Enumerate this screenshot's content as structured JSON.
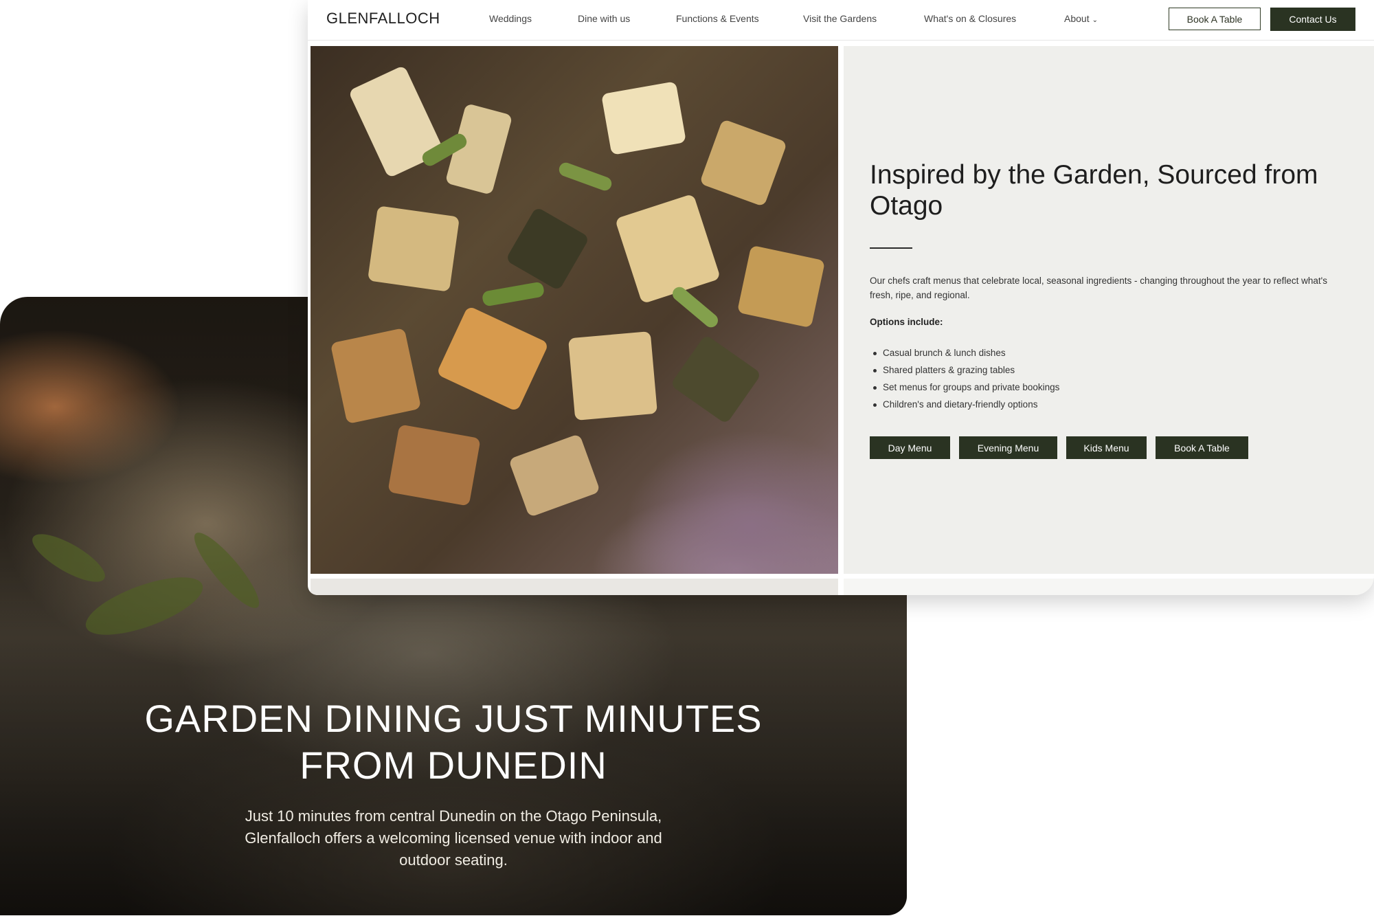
{
  "hero": {
    "title_line1": "GARDEN DINING JUST MINUTES",
    "title_line2": "FROM DUNEDIN",
    "text": "Just 10 minutes from central Dunedin on the Otago Peninsula, Glenfalloch offers a welcoming licensed venue with indoor and outdoor seating."
  },
  "nav": {
    "logo": "GLENFALLOCH",
    "links": [
      "Weddings",
      "Dine with us",
      "Functions & Events",
      "Visit the Gardens",
      "What's on & Closures",
      "About"
    ],
    "about_caret": "⌄",
    "book_label": "Book A Table",
    "contact_label": "Contact Us"
  },
  "panel": {
    "title": "Inspired by the Garden, Sourced from Otago",
    "description": "Our chefs craft menus that celebrate local, seasonal ingredients - changing throughout the year to reflect what's fresh, ripe, and regional.",
    "options_heading": "Options include:",
    "options": [
      "Casual brunch & lunch dishes",
      "Shared platters & grazing tables",
      "Set menus for groups and private bookings",
      "Children's and dietary-friendly options"
    ],
    "buttons": [
      "Day Menu",
      "Evening Menu",
      "Kids Menu",
      "Book A Table"
    ]
  },
  "colors": {
    "accent_dark_green": "#2a3322",
    "panel_bg": "#efefec",
    "text_dark": "#1e1e1e"
  }
}
